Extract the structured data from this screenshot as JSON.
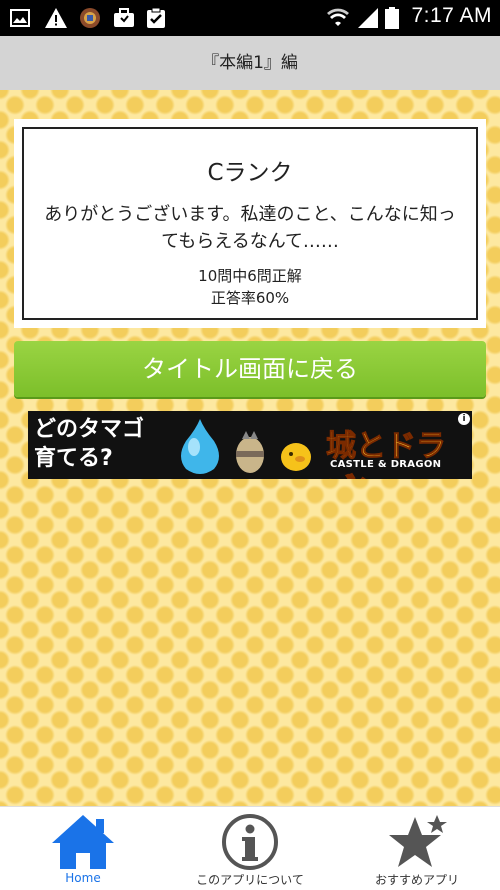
{
  "status_bar": {
    "time": "7:17 AM",
    "icons": [
      "image-icon",
      "warning-icon",
      "app-icon",
      "briefcase-icon",
      "clipboard-check-icon",
      "wifi-icon",
      "signal-icon",
      "battery-icon"
    ]
  },
  "title_bar": {
    "title": "『本編1』編"
  },
  "result": {
    "rank": "Cランク",
    "message": "ありがとうございます。私達のこと、こんなに知ってもらえるなんて……",
    "score": "10問中6問正解",
    "accuracy": "正答率60%"
  },
  "back_button": {
    "label": "タイトル画面に戻る"
  },
  "ad": {
    "headline_line1": "どのタマゴ",
    "headline_line2": "育てる?",
    "logo_text": "城とドラゴン",
    "logo_subtext": "CASTLE & DRAGON"
  },
  "bottom_nav": {
    "items": [
      {
        "label": "Home",
        "icon": "home-icon",
        "active": true
      },
      {
        "label": "このアプリについて",
        "icon": "info-icon",
        "active": false
      },
      {
        "label": "おすすめアプリ",
        "icon": "stars-icon",
        "active": false
      }
    ]
  },
  "colors": {
    "accent": "#1a73e8",
    "button_green": "#8ccb36",
    "title_bar": "#d4d4d4"
  }
}
